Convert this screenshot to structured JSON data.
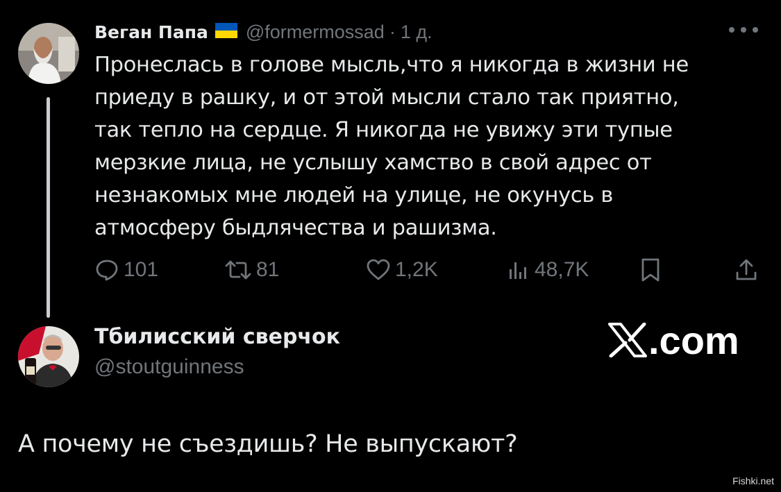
{
  "tweet": {
    "author_name": "Веган Папа",
    "author_handle": "@formermossad",
    "separator": "·",
    "time": "1 д.",
    "more_icon": "more-icon",
    "text": "Пронеслась в голове мысль,что я никогда в жизни не приеду в рашку, и от этой мысли стало так приятно, так тепло на сердце. Я никогда не увижу эти тупые мерзкие лица, не услышу хамство в свой адрес от незнакомых мне людей на улице, не окунусь в атмосферу быдлячества и рашизма.",
    "text_lines": [
      "Пронеслась в голове мысль,что я никогда в жизни не",
      "приеду в рашку, и от этой мысли стало так приятно,",
      "так тепло на сердце. Я никогда не увижу эти тупые",
      "мерзкие лица, не услышу хамство в свой адрес от",
      "незнакомых мне людей на улице, не окунусь в",
      "атмосферу быдлячества и рашизма."
    ],
    "stats": {
      "replies": "101",
      "reposts": "81",
      "likes": "1,2K",
      "views": "48,7K"
    }
  },
  "reply": {
    "author_name": "Тбилисский сверчок",
    "author_handle": "@stoutguinness",
    "text": "А почему не съездишь? Не выпускают?"
  },
  "brand": {
    "logo_text": ".com"
  },
  "watermark": "Fishki.net",
  "colors": {
    "background": "#000000",
    "text_primary": "#e7e9ea",
    "text_secondary": "#71767b",
    "flag_blue": "#0057b7",
    "flag_yellow": "#ffd700"
  }
}
